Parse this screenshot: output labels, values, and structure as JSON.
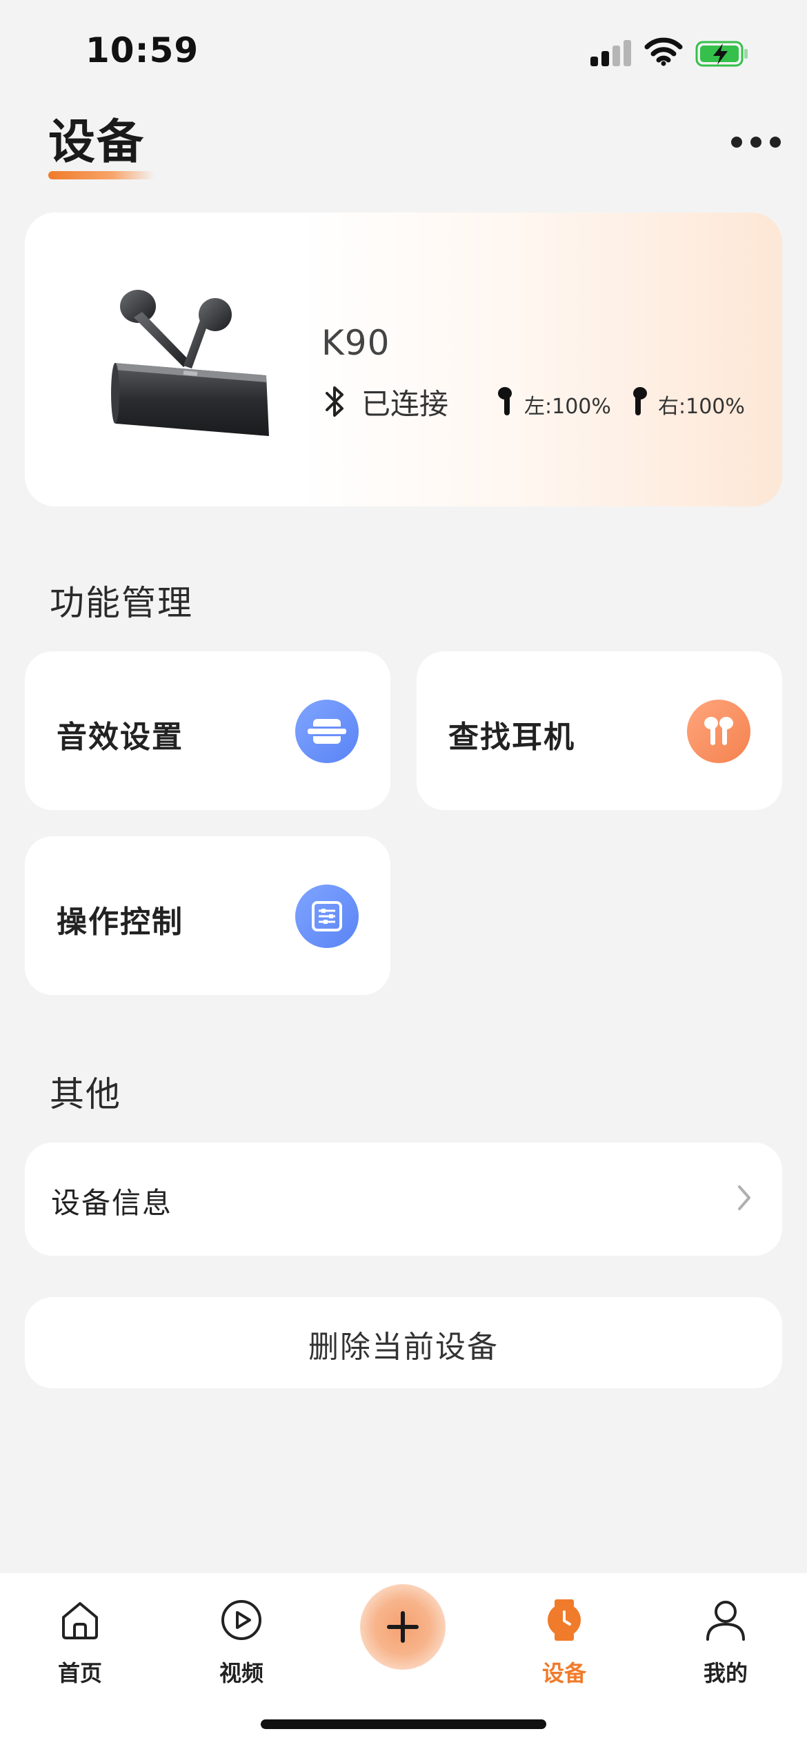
{
  "status_bar": {
    "time": "10:59"
  },
  "header": {
    "title": "设备"
  },
  "device": {
    "name": "K90",
    "connection_status": "已连接",
    "left_battery": "左:100%",
    "right_battery": "右:100%"
  },
  "functions": {
    "section_title": "功能管理",
    "items": [
      {
        "label": "音效设置",
        "icon": "sound-effect-icon",
        "color": "#6a90fb"
      },
      {
        "label": "查找耳机",
        "icon": "earbuds-icon",
        "color": "#f68c5e"
      },
      {
        "label": "操作控制",
        "icon": "control-sliders-icon",
        "color": "#6a90fb"
      }
    ]
  },
  "others": {
    "section_title": "其他",
    "device_info_label": "设备信息",
    "delete_label": "删除当前设备"
  },
  "tabbar": {
    "tabs": [
      {
        "label": "首页",
        "icon": "home-icon",
        "active": false
      },
      {
        "label": "视频",
        "icon": "play-icon",
        "active": false
      },
      {
        "label": "设备",
        "icon": "watch-icon",
        "active": true
      },
      {
        "label": "我的",
        "icon": "person-icon",
        "active": false
      }
    ],
    "add_icon": "plus-icon"
  },
  "colors": {
    "accent": "#f07b2b",
    "background": "#f3f3f3",
    "blue": "#6a90fb"
  }
}
